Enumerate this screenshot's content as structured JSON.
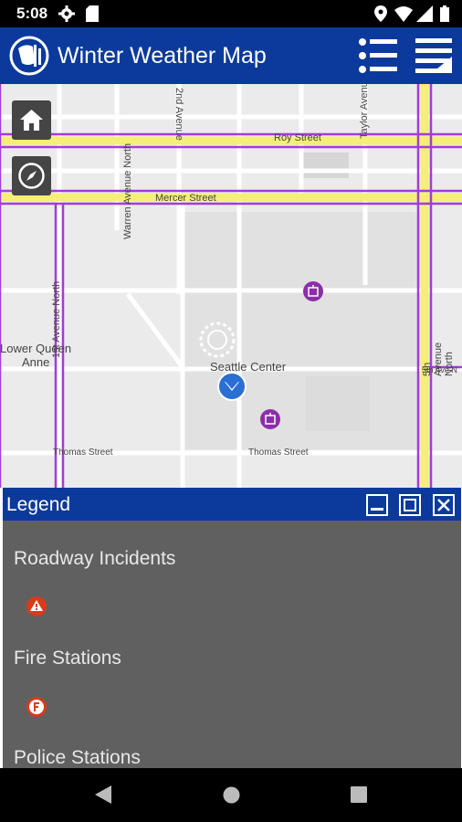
{
  "status_bar": {
    "time": "5:08",
    "icons": [
      "gear-icon",
      "sd-card-icon",
      "location-icon",
      "wifi-icon",
      "signal-icon",
      "battery-icon"
    ]
  },
  "app_bar": {
    "title": "Winter Weather Map",
    "icons": [
      "seattle-logo-icon",
      "layer-list-icon",
      "menu-icon"
    ]
  },
  "map": {
    "labels": {
      "roy_street": "Roy Street",
      "mercer_street": "Mercer Street",
      "second_ave": "2nd Avenue",
      "warren_ave": "Warren Avenue North",
      "first_ave": "1st Avenue North",
      "taylor_ave": "Taylor Avenue North",
      "fifth_ave": "5th Avenue North",
      "lower_queen_anne_1": "Lower Queen",
      "lower_queen_anne_2": "Anne",
      "seattle_center": "Seattle Center",
      "thomas_street_left": "Thomas Street",
      "thomas_street_right": "Thomas Street",
      "fifth_ave_n_label": "5th Ave N"
    },
    "buttons": [
      "home-icon",
      "compass-icon"
    ]
  },
  "legend": {
    "title": "Legend",
    "controls": [
      "minimize-icon",
      "restore-icon",
      "close-icon"
    ],
    "sections": [
      {
        "label": "Roadway Incidents",
        "symbol": "warning-icon",
        "color": "#d83b1a"
      },
      {
        "label": "Fire Stations",
        "symbol": "fire-station-icon",
        "color": "#d83b1a"
      },
      {
        "label": "Police Stations"
      }
    ]
  },
  "nav_bar": {
    "buttons": [
      "back-icon",
      "home-circle-icon",
      "recents-icon"
    ]
  },
  "colors": {
    "app_bar": "#0b3a9c",
    "road_purple": "#a63ad9",
    "road_yellow": "#f4ef77",
    "legend_bg": "#606060"
  }
}
